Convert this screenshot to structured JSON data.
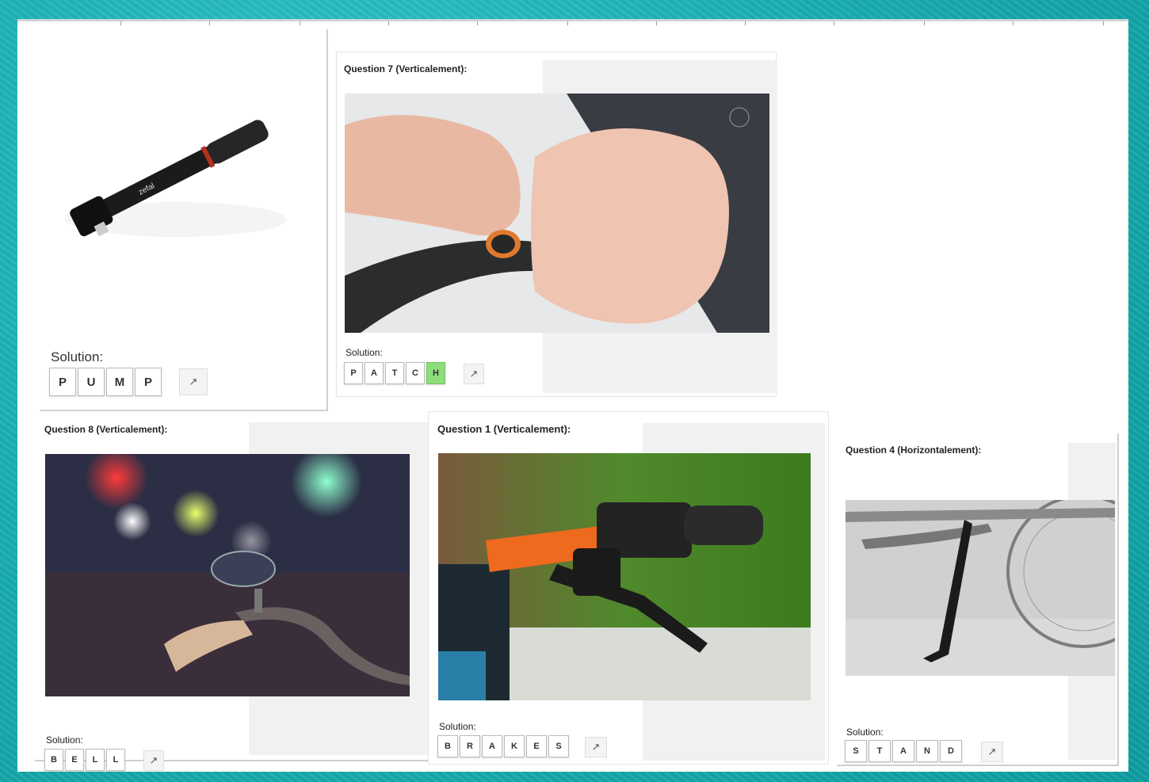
{
  "background_color": "#1aacb0",
  "cards": {
    "pump": {
      "solution_label": "Solution:",
      "letters": [
        "P",
        "U",
        "M",
        "P"
      ],
      "highlight_index": -1
    },
    "q7": {
      "title": "Question 7 (Verticalement):",
      "solution_label": "Solution:",
      "letters": [
        "P",
        "A",
        "T",
        "C",
        "H"
      ],
      "highlight_index": 4
    },
    "q8": {
      "title": "Question 8 (Verticalement):",
      "solution_label": "Solution:",
      "letters": [
        "B",
        "E",
        "L",
        "L"
      ],
      "highlight_index": -1
    },
    "q1": {
      "title": "Question 1 (Verticalement):",
      "solution_label": "Solution:",
      "letters": [
        "B",
        "R",
        "A",
        "K",
        "E",
        "S"
      ],
      "highlight_index": -1
    },
    "q4": {
      "title": "Question 4 (Horizontalement):",
      "solution_label": "Solution:",
      "letters": [
        "S",
        "T",
        "A",
        "N",
        "D"
      ],
      "highlight_index": -1
    }
  },
  "images": {
    "pump": "bicycle-pump-image",
    "q7": "tube-patch-image",
    "q8": "bicycle-bell-image",
    "q1": "brake-lever-image",
    "q4": "kickstand-image"
  },
  "colors": {
    "highlight": "#8ddd7c"
  }
}
